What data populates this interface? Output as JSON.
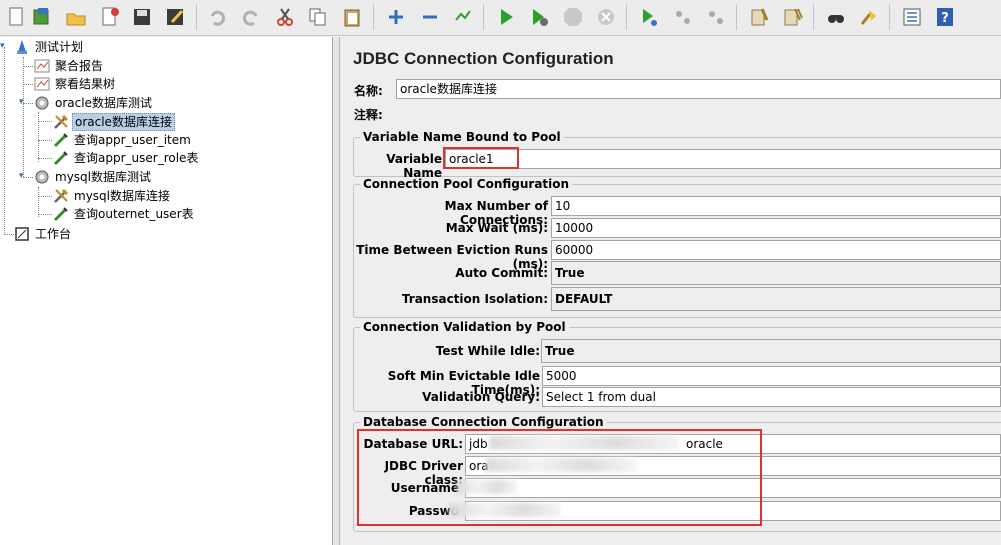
{
  "toolbar": {
    "icons": [
      "new-icon",
      "templates-icon",
      "open-icon",
      "close-icon",
      "save-icon",
      "save-as-icon",
      "undo-icon",
      "redo-icon",
      "cut-icon",
      "copy-icon",
      "paste-icon",
      "expand-icon",
      "collapse-icon",
      "toggle-icon",
      "start-icon",
      "start-no-pause-icon",
      "stop-icon",
      "shutdown-icon",
      "remote-start-icon",
      "remote-stop-icon",
      "remote-shutdown-icon",
      "clear-icon",
      "clear-all-icon",
      "search-icon",
      "reset-search-icon",
      "function-helper-icon",
      "help-icon"
    ]
  },
  "tree": {
    "nodes": [
      {
        "label": "测试计划",
        "icon": "test-plan-icon"
      },
      {
        "label": "聚合报告",
        "icon": "report-icon"
      },
      {
        "label": "察看结果树",
        "icon": "report-icon"
      },
      {
        "label": "oracle数据库测试",
        "icon": "thread-group-icon"
      },
      {
        "label": "oracle数据库连接",
        "icon": "config-element-icon"
      },
      {
        "label": "查询appr_user_item",
        "icon": "sampler-icon"
      },
      {
        "label": "查询appr_user_role表",
        "icon": "sampler-icon"
      },
      {
        "label": "mysql数据库测试",
        "icon": "thread-group-icon"
      },
      {
        "label": "mysql数据库连接",
        "icon": "config-element-icon"
      },
      {
        "label": "查询outernet_user表",
        "icon": "sampler-icon"
      },
      {
        "label": "工作台",
        "icon": "workbench-icon"
      }
    ]
  },
  "panel": {
    "title": "JDBC Connection Configuration",
    "name_label": "名称:",
    "name_value": "oracle数据库连接",
    "comment_label": "注释:",
    "comment_value": ""
  },
  "pool_var": {
    "title": "Variable Name Bound to Pool",
    "label": "Variable Name",
    "value": "oracle1"
  },
  "pool_cfg": {
    "title": "Connection Pool Configuration",
    "max_conn_label": "Max Number of Connections:",
    "max_conn_value": "10",
    "max_wait_label": "Max Wait (ms):",
    "max_wait_value": "10000",
    "eviction_label": "Time Between Eviction Runs (ms):",
    "eviction_value": "60000",
    "autocommit_label": "Auto Commit:",
    "autocommit_value": "True",
    "isolation_label": "Transaction Isolation:",
    "isolation_value": "DEFAULT"
  },
  "validation": {
    "title": "Connection Validation by Pool",
    "test_idle_label": "Test While Idle:",
    "test_idle_value": "True",
    "soft_min_label": "Soft Min Evictable Idle Time(ms):",
    "soft_min_value": "5000",
    "query_label": "Validation Query:",
    "query_value": "Select 1 from dual"
  },
  "db": {
    "title": "Database Connection Configuration",
    "url_label": "Database URL:",
    "url_prefix": "jdb",
    "url_suffix": "oracle",
    "driver_label": "JDBC Driver class:",
    "driver_prefix": "ora",
    "user_label": "Username",
    "pass_label": "Passwo"
  },
  "colors": {
    "highlight": "#e03131",
    "selection": "#b8cfe5"
  }
}
